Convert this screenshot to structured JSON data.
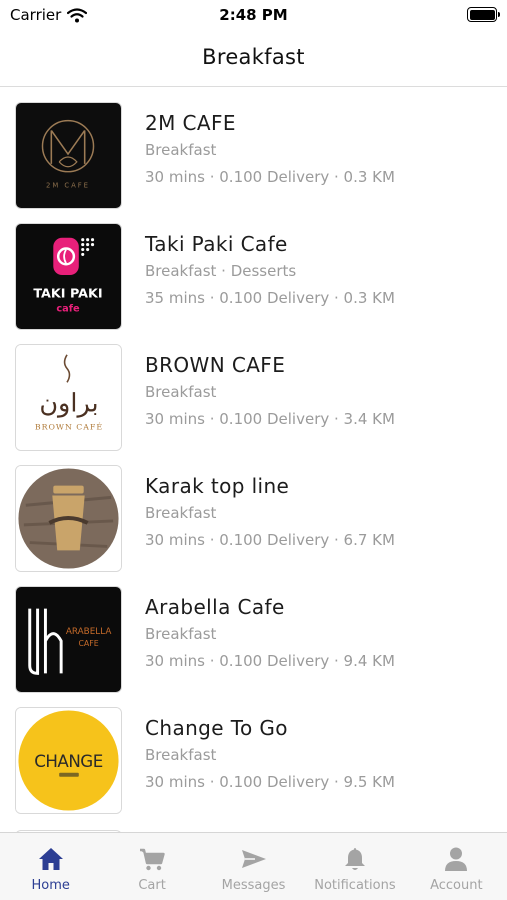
{
  "status_bar": {
    "carrier": "Carrier",
    "time": "2:48 PM"
  },
  "header": {
    "title": "Breakfast"
  },
  "restaurants": [
    {
      "name": "2M CAFE",
      "categories": "Breakfast",
      "meta": "30 mins · 0.100 Delivery · 0.3 KM",
      "logo_icon": "2m-cafe-logo",
      "logo_text": "2M CAFE"
    },
    {
      "name": "Taki Paki Cafe",
      "categories": "Breakfast ·  Desserts",
      "meta": "35 mins · 0.100 Delivery · 0.3 KM",
      "logo_icon": "taki-paki-logo",
      "logo_text": "TAKI PAKI",
      "logo_subtext": "cafe"
    },
    {
      "name": "BROWN CAFE",
      "categories": "Breakfast",
      "meta": "30 mins · 0.100 Delivery · 3.4 KM",
      "logo_icon": "brown-cafe-logo",
      "logo_text": "براون",
      "logo_subtext": "BROWN CAFÉ"
    },
    {
      "name": "Karak top line",
      "categories": "Breakfast",
      "meta": "30 mins · 0.100 Delivery · 6.7 KM",
      "logo_icon": "karak-cup-logo"
    },
    {
      "name": "Arabella Cafe",
      "categories": "Breakfast",
      "meta": "30 mins · 0.100 Delivery · 9.4 KM",
      "logo_icon": "arabella-logo",
      "logo_text": "ARABELLA",
      "logo_subtext": "CAFE"
    },
    {
      "name": "Change To Go",
      "categories": "Breakfast",
      "meta": "30 mins · 0.100 Delivery · 9.5 KM",
      "logo_icon": "change-logo",
      "logo_text": "CHANGE"
    }
  ],
  "tab_bar": {
    "active": "home",
    "tabs": [
      {
        "id": "home",
        "label": "Home",
        "icon": "home-icon"
      },
      {
        "id": "cart",
        "label": "Cart",
        "icon": "cart-icon"
      },
      {
        "id": "messages",
        "label": "Messages",
        "icon": "send-icon"
      },
      {
        "id": "notifications",
        "label": "Notifications",
        "icon": "bell-icon"
      },
      {
        "id": "account",
        "label": "Account",
        "icon": "user-icon"
      }
    ]
  },
  "colors": {
    "accent": "#2c3e93",
    "inactive": "#a4a4a4",
    "secondary_text": "#9b9b9b",
    "taki_pink": "#e8207a",
    "change_yellow": "#f6c31b"
  }
}
